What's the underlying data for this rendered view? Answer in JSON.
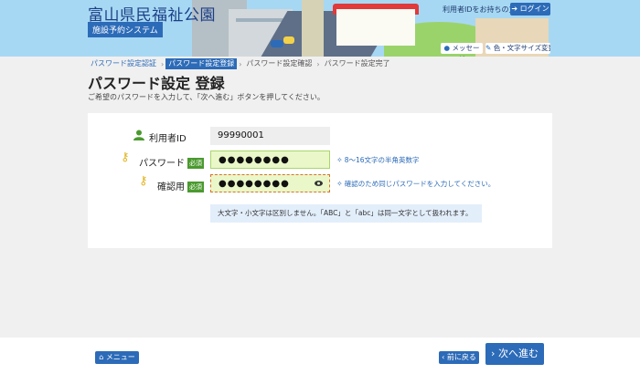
{
  "header": {
    "site_title": "富山県民福祉公園",
    "system_name": "施設予約システム",
    "login_prompt": "利用者IDをお持ちの方",
    "login_button": "ログイン",
    "message_button": "メッセージ",
    "font_button": "色・文字サイズ変更"
  },
  "breadcrumbs": [
    {
      "label": "パスワード設定認証"
    },
    {
      "label": "パスワード設定登録"
    },
    {
      "label": "パスワード設定確認"
    },
    {
      "label": "パスワード設定完了"
    }
  ],
  "page": {
    "title": "パスワード設定 登録",
    "instruction": "ご希望のパスワードを入力して、「次へ進む」ボタンを押してください。"
  },
  "form": {
    "user_id_label": "利用者ID",
    "user_id_value": "99990001",
    "password_label": "パスワード",
    "confirm_label": "確認用",
    "required_badge": "必須",
    "password_value": "●●●●●●●●",
    "confirm_value": "●●●●●●●●",
    "password_hint": "8～16文字の半角英数字",
    "confirm_hint": "確認のため同じパスワードを入力してください。",
    "case_note": "大文字・小文字は区別しません。「ABC」と「abc」は同一文字として扱われます。"
  },
  "footer": {
    "menu_button": "メニュー",
    "back_button": "前に戻る",
    "next_button": "次へ進む"
  },
  "colors": {
    "primary": "#2c6bb8",
    "required_badge": "#4b9a2f",
    "input_bg": "#eaf7c9"
  }
}
